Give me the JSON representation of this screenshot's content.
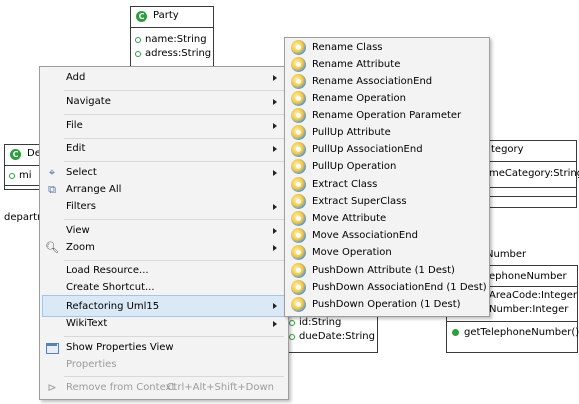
{
  "diagram": {
    "party": {
      "name": "Party",
      "attributes": [
        "name:String",
        "adress:String"
      ]
    },
    "department": {
      "name": "De",
      "attributes": [
        "mi"
      ],
      "label_below": "departm"
    },
    "contract_category": {
      "name": "tegory",
      "attributes": [
        "meCategory:String"
      ]
    },
    "telephone_number": {
      "name_outside": "Number",
      "header": "ephoneNumber",
      "attributes": [
        "AreaCode:Integer",
        "Number:Integer"
      ],
      "operations": [
        "getTelephoneNumber()"
      ]
    },
    "hidden_class": {
      "attributes": [
        "id:String",
        "dueDate:String"
      ]
    },
    "colors": {
      "class_icon": "#2f9d3f",
      "highlight": "#dbe9f7",
      "menu_bg": "#f3f3f3"
    }
  },
  "context_menu": {
    "items": [
      {
        "label": "Add",
        "icon": "",
        "submenu": true
      },
      {
        "label": "Navigate",
        "icon": "",
        "submenu": true
      },
      {
        "label": "File",
        "icon": "",
        "submenu": true
      },
      {
        "label": "Edit",
        "icon": "",
        "submenu": true
      },
      {
        "label": "Select",
        "icon": "select-icon",
        "submenu": true
      },
      {
        "label": "Arrange All",
        "icon": "arrange-icon"
      },
      {
        "label": "Filters",
        "icon": "",
        "submenu": true
      },
      {
        "label": "View",
        "icon": "",
        "submenu": true
      },
      {
        "label": "Zoom",
        "icon": "zoom-icon",
        "submenu": true
      },
      {
        "label": "Load Resource..."
      },
      {
        "label": "Create Shortcut..."
      },
      {
        "label": "Refactoring Uml15",
        "submenu": true,
        "highlighted": true
      },
      {
        "label": "WikiText",
        "submenu": true
      },
      {
        "label": "Show Properties View",
        "icon": "properties-view-icon"
      },
      {
        "label": "Properties",
        "disabled": true
      },
      {
        "label": "Remove from Context",
        "icon": "remove-context-icon",
        "disabled": true,
        "shortcut": "Ctrl+Alt+Shift+Down"
      }
    ]
  },
  "refactoring_submenu": {
    "items": [
      "Rename Class",
      "Rename Attribute",
      "Rename AssociationEnd",
      "Rename Operation",
      "Rename Operation Parameter",
      "PullUp Attribute",
      "PullUp AssociationEnd",
      "PullUp Operation",
      "Extract Class",
      "Extract SuperClass",
      "Move Attribute",
      "Move AssociationEnd",
      "Move Operation",
      "PushDown Attribute (1 Dest)",
      "PushDown AssociationEnd (1 Dest)",
      "PushDown Operation (1 Dest)"
    ]
  }
}
